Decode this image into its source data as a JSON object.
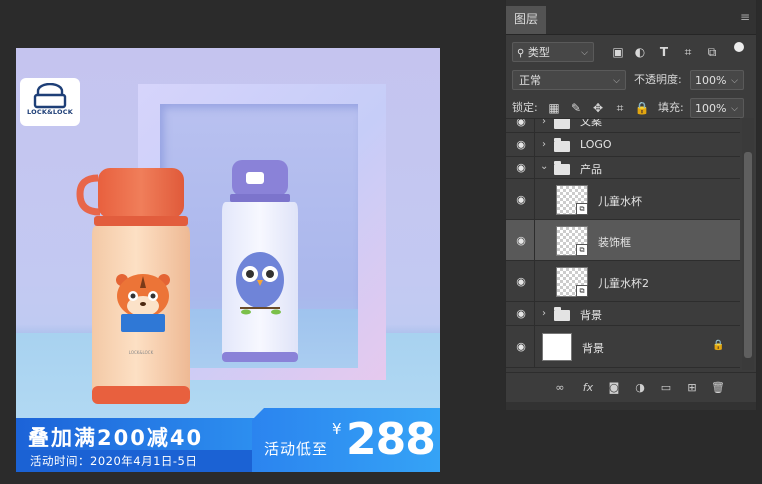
{
  "banner": {
    "brand": "LOCK&LOCK",
    "promo_title": "叠加满200减40",
    "promo_subtitle": "活动时间：2020年4月1日-5日",
    "promo_label": "活动低至",
    "currency": "¥",
    "price": "288",
    "bottle_label": "LOCK&LOCK"
  },
  "layers_panel": {
    "tab": "图层",
    "filter_kind": "类型",
    "blend_mode": "正常",
    "opacity_label": "不透明度:",
    "opacity_value": "100%",
    "lock_label": "锁定:",
    "fill_label": "填充:",
    "fill_value": "100%",
    "layers": [
      {
        "name": "文案",
        "type": "group",
        "expanded": false
      },
      {
        "name": "LOGO",
        "type": "group",
        "expanded": false
      },
      {
        "name": "产品",
        "type": "group",
        "expanded": true
      },
      {
        "name": "儿童水杯",
        "type": "smart-object",
        "selected": false
      },
      {
        "name": "装饰框",
        "type": "smart-object",
        "selected": true
      },
      {
        "name": "儿童水杯2",
        "type": "smart-object",
        "selected": false
      },
      {
        "name": "背景",
        "type": "group",
        "expanded": false
      },
      {
        "name": "背景",
        "type": "background",
        "locked": true
      }
    ],
    "colors": {
      "panel_bg": "#3c3c3c",
      "selected_row": "#595959",
      "accent_blue": "#2d8ff0"
    }
  }
}
